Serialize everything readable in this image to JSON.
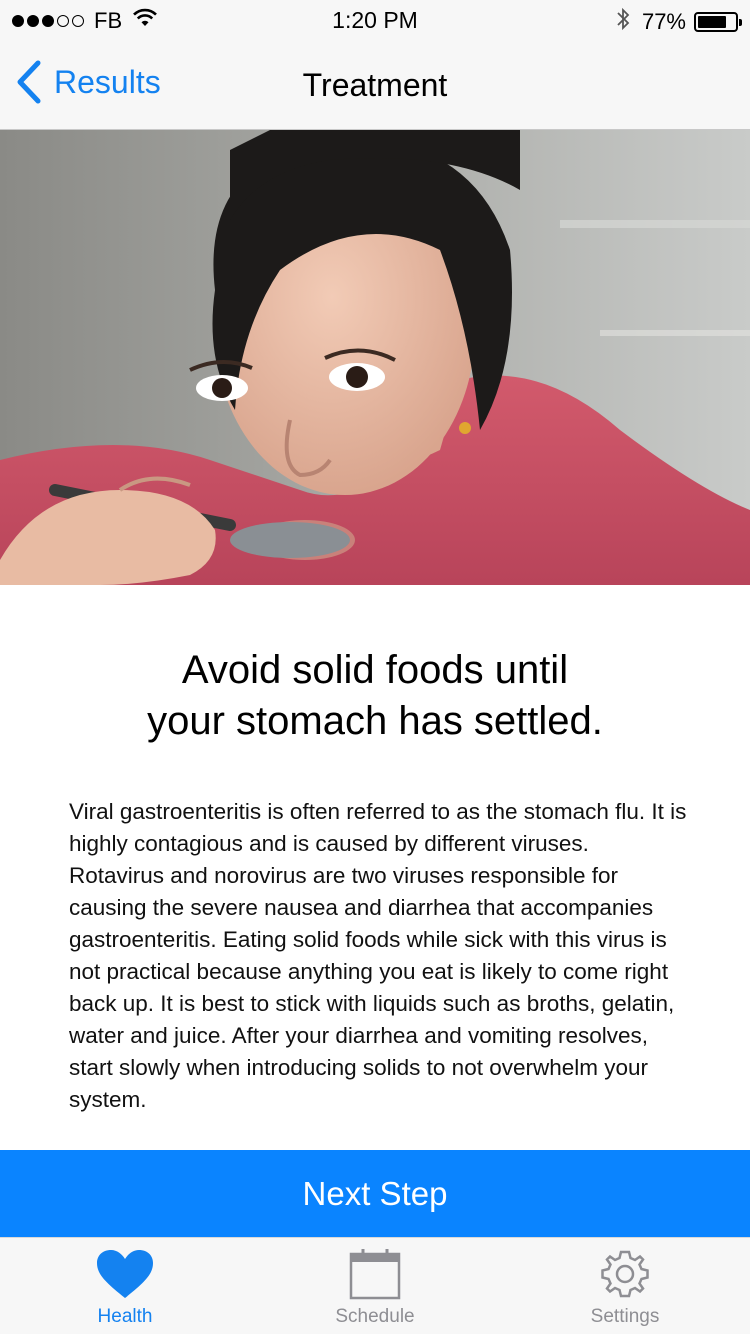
{
  "status_bar": {
    "carrier": "FB",
    "time": "1:20 PM",
    "battery": "77%",
    "battery_fraction": 0.77,
    "signal_filled": 3,
    "signal_total": 5
  },
  "nav": {
    "back_label": "Results",
    "title": "Treatment"
  },
  "hero": {
    "subject": "woman-eating-with-spoon"
  },
  "content": {
    "headline_line1": "Avoid solid foods until",
    "headline_line2": "your stomach has settled.",
    "body": "Viral gastroenteritis is often referred to as the stomach flu. It is highly contagious and is caused by different viruses. Rotavirus and norovirus are two viruses responsible for causing the severe nausea and diarrhea that accompanies gastroenteritis. Eating solid foods while sick with this virus is not practical because anything you eat is likely to come right back up. It is best to stick with liquids such as broths, gelatin, water and juice. After your diarrhea and vomiting resolves, start slowly when introducing solids to not overwhelm your system."
  },
  "cta": {
    "label": "Next Step"
  },
  "tab_bar": {
    "items": [
      {
        "label": "Health",
        "icon": "heart-icon",
        "active": true
      },
      {
        "label": "Schedule",
        "icon": "calendar-icon",
        "active": false
      },
      {
        "label": "Settings",
        "icon": "gear-icon",
        "active": false
      }
    ]
  },
  "colors": {
    "accent": "#1482f0",
    "cta": "#0a84ff",
    "inactive": "#8e8e93"
  }
}
